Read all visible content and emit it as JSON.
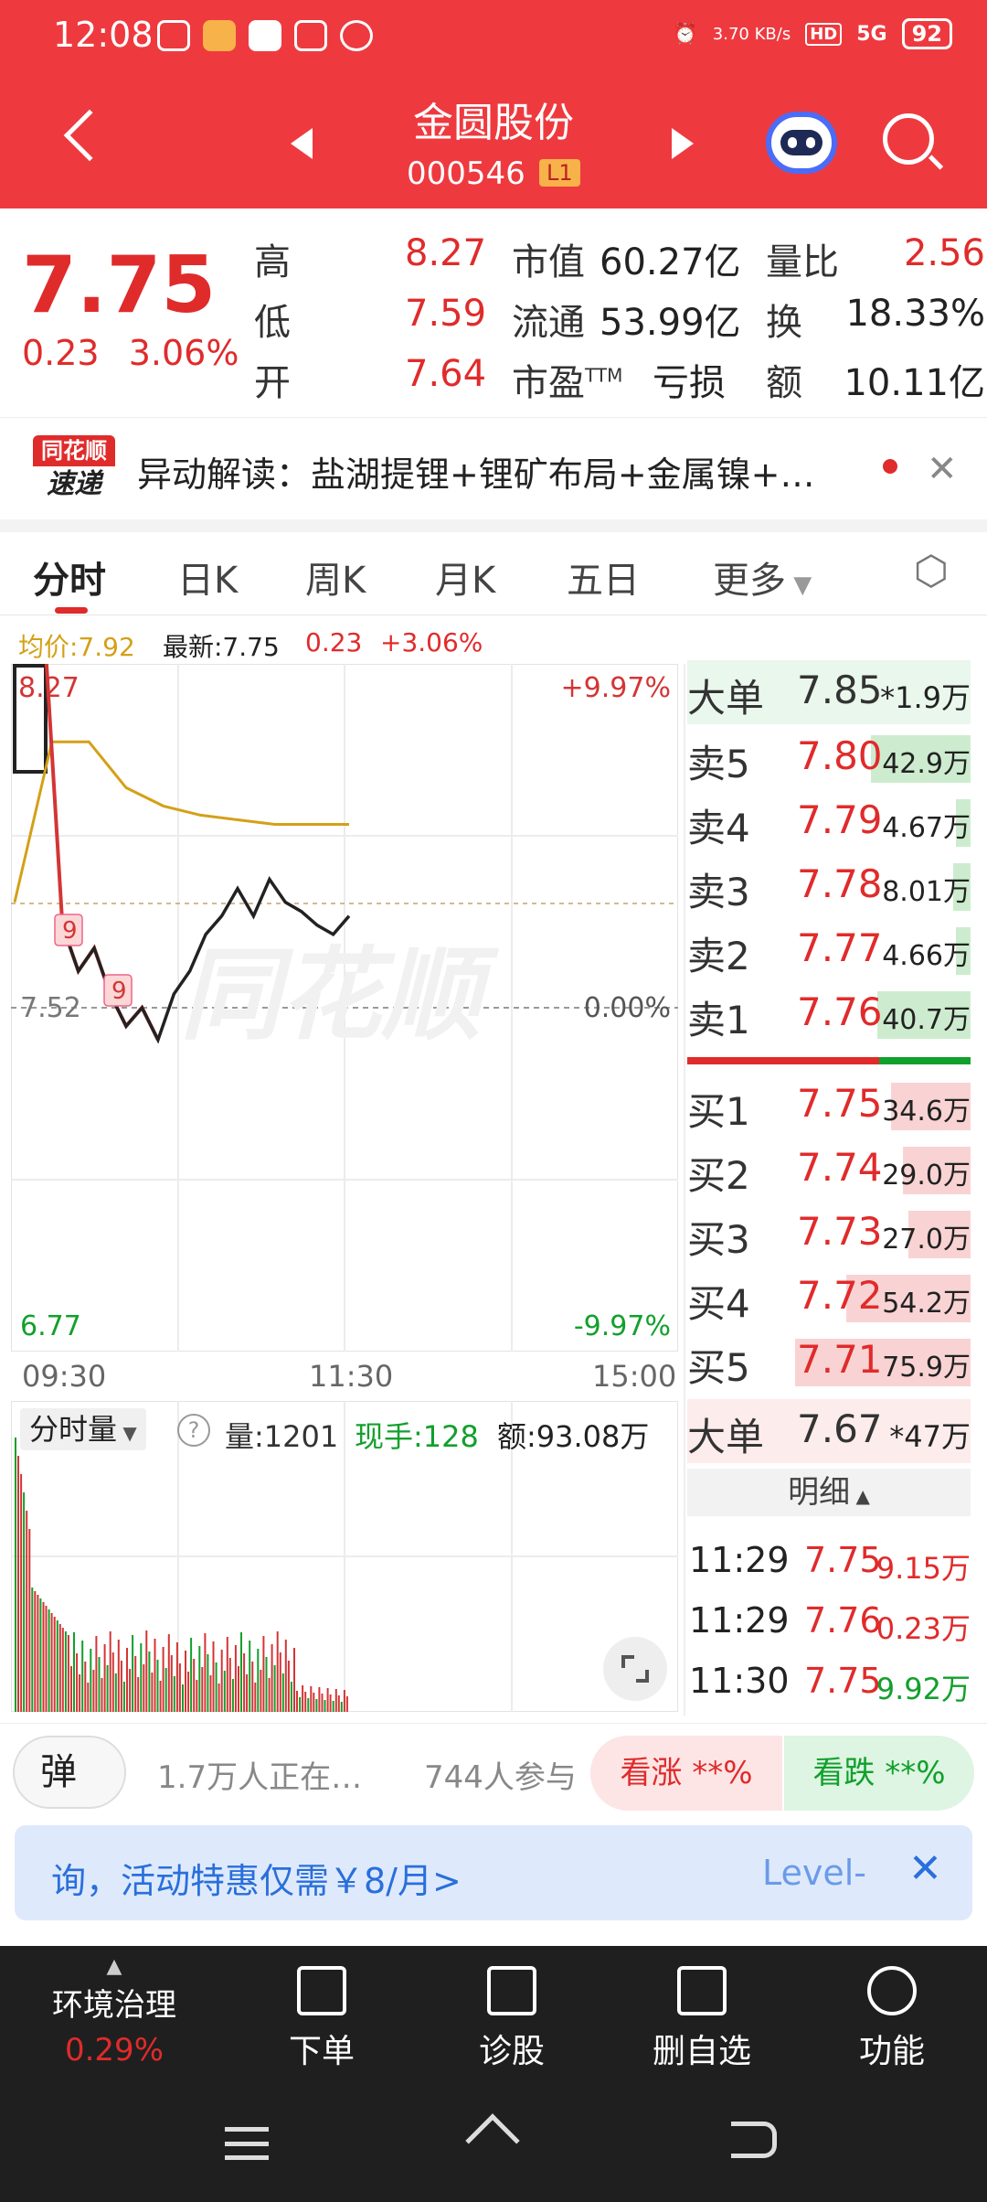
{
  "status_bar": {
    "time": "12:08",
    "net_speed": "3.70 KB/s",
    "battery": "92",
    "net": "5G"
  },
  "header": {
    "stock_name": "金圆股份",
    "stock_code": "000546",
    "level_badge": "L1"
  },
  "quote": {
    "price": "7.75",
    "change": "0.23",
    "change_pct": "3.06%",
    "rows": [
      {
        "l1": "高",
        "v1": "8.27",
        "l2": "市值",
        "v2": "60.27亿",
        "l3": "量比",
        "v3": "2.56"
      },
      {
        "l1": "低",
        "v1": "7.59",
        "l2": "流通",
        "v2": "53.99亿",
        "l3": "换",
        "v3": "18.33%"
      },
      {
        "l1": "开",
        "v1": "7.64",
        "l2": "市盈",
        "l2_sup": "TTM",
        "v2": "亏损",
        "l3": "额",
        "v3": "10.11亿"
      }
    ]
  },
  "alert": {
    "logo_top": "同花顺",
    "logo_bottom": "速递",
    "text": "异动解读：盐湖提锂+锂矿布局+金属镍+…"
  },
  "tabs": [
    "分时",
    "日K",
    "周K",
    "月K",
    "五日",
    "更多"
  ],
  "legend": {
    "avg": "均价:7.92",
    "latest": "最新:7.75",
    "chg": "0.23",
    "pct": "+3.06%"
  },
  "chart": {
    "y_high": "8.27",
    "y_mid": "7.52",
    "y_low": "6.77",
    "pct_high": "+9.97%",
    "pct_mid": "0.00%",
    "pct_low": "-9.97%",
    "x_ticks": [
      "09:30",
      "11:30",
      "15:00"
    ],
    "marker": "9",
    "watermark": "同花顺",
    "price_series": [
      7.65,
      8.27,
      8.27,
      7.7,
      7.6,
      7.65,
      7.55,
      7.48,
      7.52,
      7.45,
      7.55,
      7.6,
      7.68,
      7.72,
      7.78,
      7.72,
      7.8,
      7.75,
      7.73,
      7.7,
      7.68,
      7.72
    ],
    "avg_series": [
      7.75,
      8.1,
      8.1,
      8.0,
      7.96,
      7.94,
      7.93,
      7.92,
      7.92,
      7.92
    ]
  },
  "volume": {
    "label": "分时量",
    "vol": "量:1201",
    "hand": "现手:128",
    "amount": "额:93.08万"
  },
  "order_book": {
    "big_sell": {
      "label": "大单",
      "price": "7.85",
      "vol": "1.9万"
    },
    "asks": [
      {
        "label": "卖5",
        "price": "7.80",
        "vol": "42.9万",
        "fill": 0.35
      },
      {
        "label": "卖4",
        "price": "7.79",
        "vol": "4.67万",
        "fill": 0.05
      },
      {
        "label": "卖3",
        "price": "7.78",
        "vol": "8.01万",
        "fill": 0.06
      },
      {
        "label": "卖2",
        "price": "7.77",
        "vol": "4.66万",
        "fill": 0.05
      },
      {
        "label": "卖1",
        "price": "7.76",
        "vol": "40.7万",
        "fill": 0.33
      }
    ],
    "bids": [
      {
        "label": "买1",
        "price": "7.75",
        "vol": "34.6万",
        "fill": 0.28
      },
      {
        "label": "买2",
        "price": "7.74",
        "vol": "29.0万",
        "fill": 0.24
      },
      {
        "label": "买3",
        "price": "7.73",
        "vol": "27.0万",
        "fill": 0.22
      },
      {
        "label": "买4",
        "price": "7.72",
        "vol": "54.2万",
        "fill": 0.44
      },
      {
        "label": "买5",
        "price": "7.71",
        "vol": "75.9万",
        "fill": 0.62
      }
    ],
    "big_buy": {
      "label": "大单",
      "price": "7.67",
      "vol": "47万"
    },
    "detail_label": "明细",
    "ticks": [
      {
        "time": "11:29",
        "price": "7.75",
        "vol": "9.15万"
      },
      {
        "time": "11:29",
        "price": "7.76",
        "vol": "0.23万"
      },
      {
        "time": "11:30",
        "price": "7.75",
        "vol": "9.92万"
      }
    ]
  },
  "social": {
    "danmu": "弹",
    "watching": "1.7万人正在…",
    "participants": "744人参与",
    "up": "看涨 **%",
    "down": "看跌 **%"
  },
  "promo": {
    "text": "询，活动特惠仅需￥8/月>",
    "level": "Level-"
  },
  "bottom_nav": {
    "sector": "环境治理",
    "sector_pct": "0.29%",
    "items": [
      "下单",
      "诊股",
      "删自选",
      "功能"
    ]
  },
  "colors": {
    "red": "#ee3a3f",
    "rise": "#e02b2b",
    "fall": "#12a02c",
    "avg_line": "#d4a017"
  }
}
